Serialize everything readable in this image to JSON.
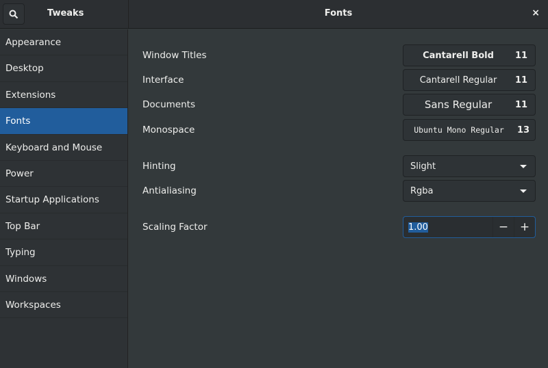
{
  "header": {
    "app_title": "Tweaks",
    "page_title": "Fonts",
    "close": "×"
  },
  "sidebar": {
    "items": [
      "Appearance",
      "Desktop",
      "Extensions",
      "Fonts",
      "Keyboard and Mouse",
      "Power",
      "Startup Applications",
      "Top Bar",
      "Typing",
      "Windows",
      "Workspaces"
    ],
    "selected": "Fonts"
  },
  "fonts": {
    "window_titles": {
      "label": "Window Titles",
      "font": "Cantarell Bold",
      "size": "11"
    },
    "interface": {
      "label": "Interface",
      "font": "Cantarell Regular",
      "size": "11"
    },
    "documents": {
      "label": "Documents",
      "font": "Sans Regular",
      "size": "11"
    },
    "monospace": {
      "label": "Monospace",
      "font": "Ubuntu Mono Regular",
      "size": "13"
    },
    "hinting": {
      "label": "Hinting",
      "value": "Slight"
    },
    "antialiasing": {
      "label": "Antialiasing",
      "value": "Rgba"
    },
    "scaling": {
      "label": "Scaling Factor",
      "value": "1.00",
      "minus": "−",
      "plus": "+"
    }
  },
  "colors": {
    "accent": "#215d9c"
  }
}
